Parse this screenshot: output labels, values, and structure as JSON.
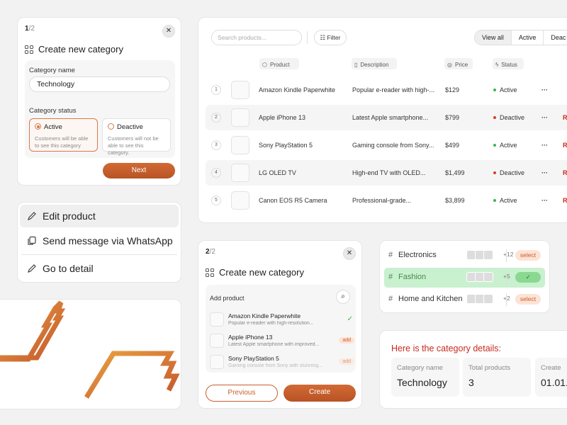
{
  "create_step1": {
    "step_current": "1",
    "step_total": "/2",
    "close": "✕",
    "title": "Create new category",
    "name_label": "Category name",
    "name_value": "Technology",
    "status_label": "Category status",
    "options": [
      {
        "label": "Active",
        "desc": "Customers will be able to see this category",
        "selected": true
      },
      {
        "label": "Deactive",
        "desc": "Customers will not be able to see this category.",
        "selected": false
      }
    ],
    "next_label": "Next"
  },
  "context_menu": {
    "items": [
      {
        "label": "Edit product",
        "icon": "pencil-icon"
      },
      {
        "label": "Send message via WhatsApp",
        "icon": "copy-icon"
      },
      {
        "label": "Go to detail",
        "icon": "pencil-icon"
      }
    ]
  },
  "products_table": {
    "search_placeholder": "Search products...",
    "filter_label": "Filter",
    "views": [
      "View all",
      "Active",
      "Deac"
    ],
    "active_view": "View all",
    "columns": [
      "Product",
      "Description",
      "Price",
      "Status"
    ],
    "rows": [
      {
        "n": "1",
        "product": "Amazon Kindle Paperwhite",
        "desc": "Popular e-reader with high-...",
        "price": "$129",
        "status": "Active",
        "action": "..."
      },
      {
        "n": "2",
        "product": "Apple iPhone 13",
        "desc": "Latest Apple smartphone...",
        "price": "$799",
        "status": "Deactive",
        "action": "Re"
      },
      {
        "n": "3",
        "product": "Sony PlayStation 5",
        "desc": "Gaming console from Sony...",
        "price": "$499",
        "status": "Active",
        "action": "Re"
      },
      {
        "n": "4",
        "product": "LG OLED TV",
        "desc": "High-end TV with OLED...",
        "price": "$1,499",
        "status": "Deactive",
        "action": "Re"
      },
      {
        "n": "5",
        "product": "Canon EOS R5 Camera",
        "desc": "Professional-grade...",
        "price": "$3,899",
        "status": "Active",
        "action": "Re"
      }
    ],
    "status_colors": {
      "Active": "#3bb54a",
      "Deactive": "#d93a2b"
    }
  },
  "create_step2": {
    "step_current": "2",
    "step_total": "/2",
    "close": "✕",
    "title": "Create new category",
    "add_label": "Add product",
    "items": [
      {
        "name": "Amazon Kindle Paperwhite",
        "desc": "Popular e-reader with high-resolution...",
        "state": "added"
      },
      {
        "name": "Apple iPhone 13",
        "desc": "Latest Apple smartphone with improved...",
        "state": "add"
      },
      {
        "name": "Sony PlayStation 5",
        "desc": "Gaming console from Sony with stunning...",
        "state": "add"
      }
    ],
    "add_tag": "add",
    "prev_label": "Previous",
    "create_label": "Create"
  },
  "categories": [
    {
      "name": "Electronics",
      "count": "+12",
      "action": "select",
      "selected": false
    },
    {
      "name": "Fashion",
      "count": "+5",
      "action": "",
      "selected": true
    },
    {
      "name": "Home and Kitchen",
      "count": "+2",
      "action": "select",
      "selected": false
    }
  ],
  "category_details": {
    "title": "Here is the category details:",
    "fields": [
      {
        "key": "Category name",
        "value": "Technology"
      },
      {
        "key": "Total products",
        "value": "3"
      },
      {
        "key": "Create",
        "value": "01.01."
      }
    ]
  },
  "colors": {
    "accent": "#c85e2d",
    "danger": "#c62a1e",
    "success": "#3bb54a"
  }
}
